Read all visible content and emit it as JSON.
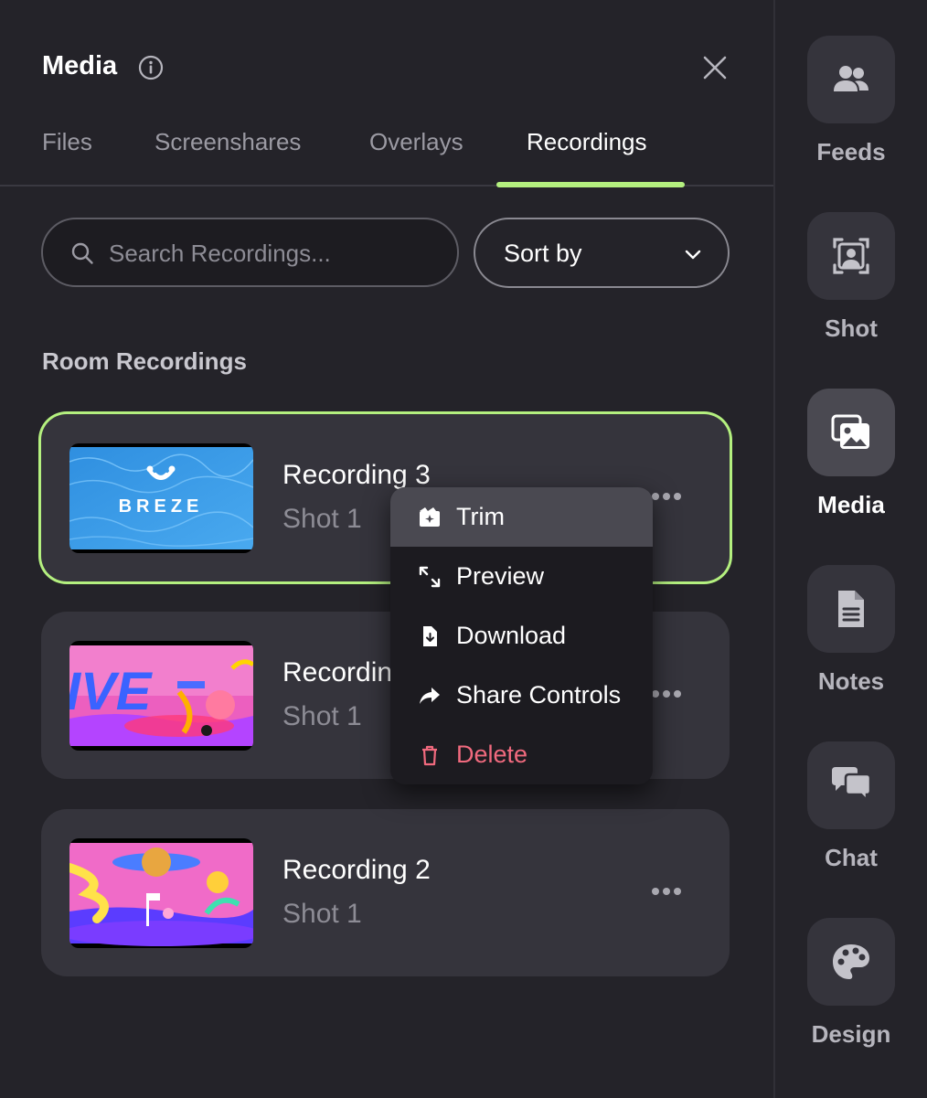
{
  "panel": {
    "title": "Media",
    "tabs": [
      {
        "label": "Files",
        "active": false
      },
      {
        "label": "Screenshares",
        "active": false
      },
      {
        "label": "Overlays",
        "active": false
      },
      {
        "label": "Recordings",
        "active": true
      }
    ],
    "search": {
      "placeholder": "Search Recordings...",
      "value": ""
    },
    "sort": {
      "label": "Sort by"
    },
    "section_title": "Room Recordings",
    "recordings": [
      {
        "name": "Recording 3",
        "shot": "Shot 1",
        "thumb_logo": "BREZE",
        "selected": true
      },
      {
        "name": "Recording 1",
        "shot": "Shot 1",
        "selected": false
      },
      {
        "name": "Recording 2",
        "shot": "Shot 1",
        "selected": false
      }
    ]
  },
  "menu": {
    "items": [
      {
        "label": "Trim",
        "icon": "trim-icon"
      },
      {
        "label": "Preview",
        "icon": "expand-icon"
      },
      {
        "label": "Download",
        "icon": "download-file-icon"
      },
      {
        "label": "Share Controls",
        "icon": "share-arrow-icon"
      },
      {
        "label": "Delete",
        "icon": "trash-icon",
        "danger": true
      }
    ]
  },
  "nav": {
    "items": [
      {
        "label": "Feeds",
        "icon": "users-icon",
        "active": false
      },
      {
        "label": "Shot",
        "icon": "shot-frame-icon",
        "active": false
      },
      {
        "label": "Media",
        "icon": "images-icon",
        "active": true
      },
      {
        "label": "Notes",
        "icon": "document-icon",
        "active": false
      },
      {
        "label": "Chat",
        "icon": "chat-bubbles-icon",
        "active": false
      },
      {
        "label": "Design",
        "icon": "palette-icon",
        "active": false
      }
    ]
  },
  "colors": {
    "background": "#242329",
    "card": "#35343c",
    "accent": "#b4f07f",
    "danger": "#f16a7e",
    "menu_bg": "#1c1b20",
    "menu_hover": "#4a4951"
  }
}
